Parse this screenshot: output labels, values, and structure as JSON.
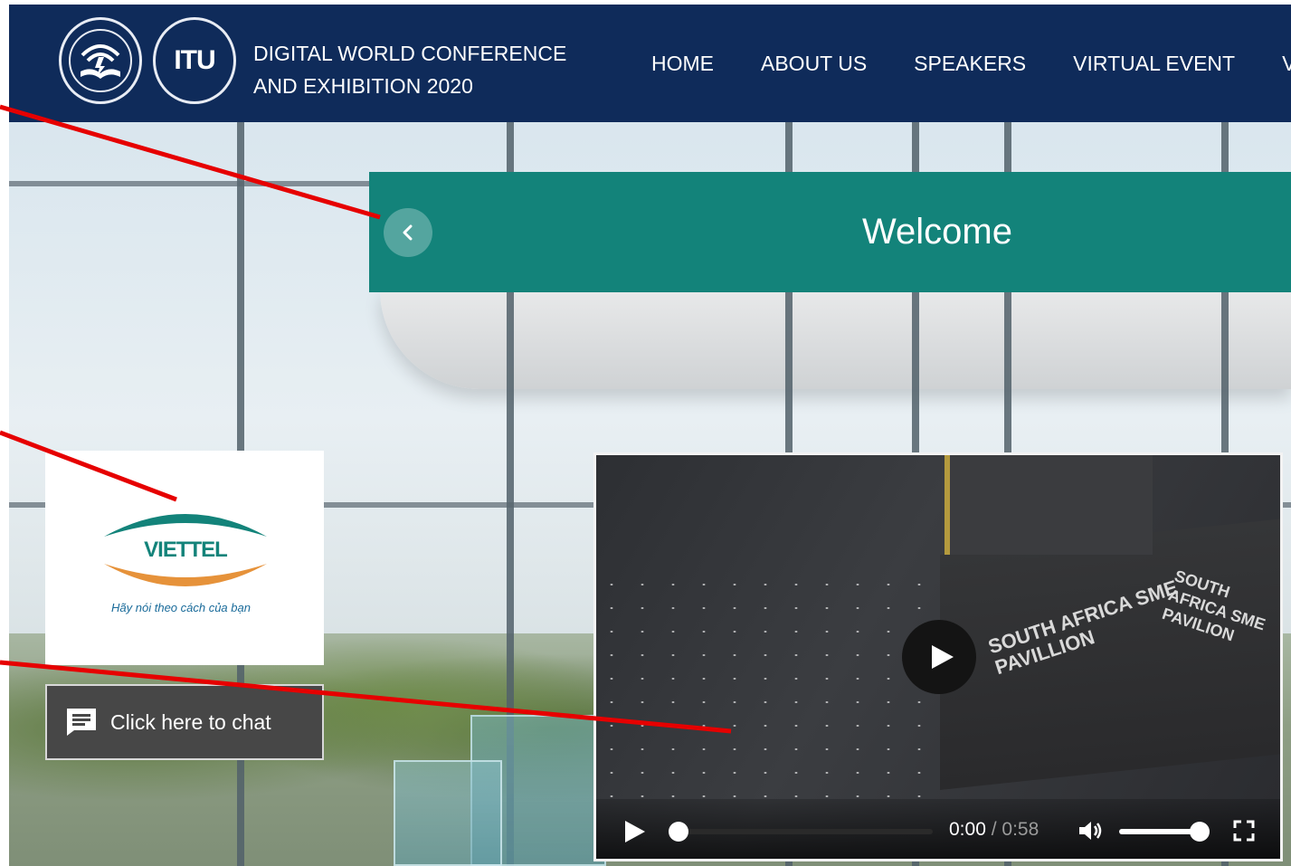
{
  "header": {
    "title_line1": "DIGITAL WORLD CONFERENCE",
    "title_line2": "AND EXHIBITION 2020",
    "logo_text": "ITU",
    "nav": [
      {
        "label": "HOME"
      },
      {
        "label": "ABOUT US"
      },
      {
        "label": "SPEAKERS"
      },
      {
        "label": "VIRTUAL EVENT"
      },
      {
        "label": "VIP"
      }
    ]
  },
  "banner": {
    "title": "Welcome",
    "prev_icon": "chevron-left-icon"
  },
  "sponsor": {
    "name": "VIETTEL",
    "tagline": "Hãy nói theo cách của bạn"
  },
  "chat": {
    "label": "Click here to chat",
    "icon": "chat-icon"
  },
  "video": {
    "booth_text": "SOUTH AFRICA SME PAVILLION",
    "booth_text_right": "SOUTH AFRICA SME PAVILION",
    "current_time": "0:00",
    "separator": " / ",
    "duration": "0:58",
    "progress": 0,
    "volume": 1,
    "icons": [
      "play-icon",
      "volume-icon",
      "fullscreen-icon"
    ]
  },
  "colors": {
    "header_bg": "#0f2b5a",
    "banner_bg": "#13837a",
    "chat_bg": "#474747",
    "annotation": "#e60000"
  }
}
